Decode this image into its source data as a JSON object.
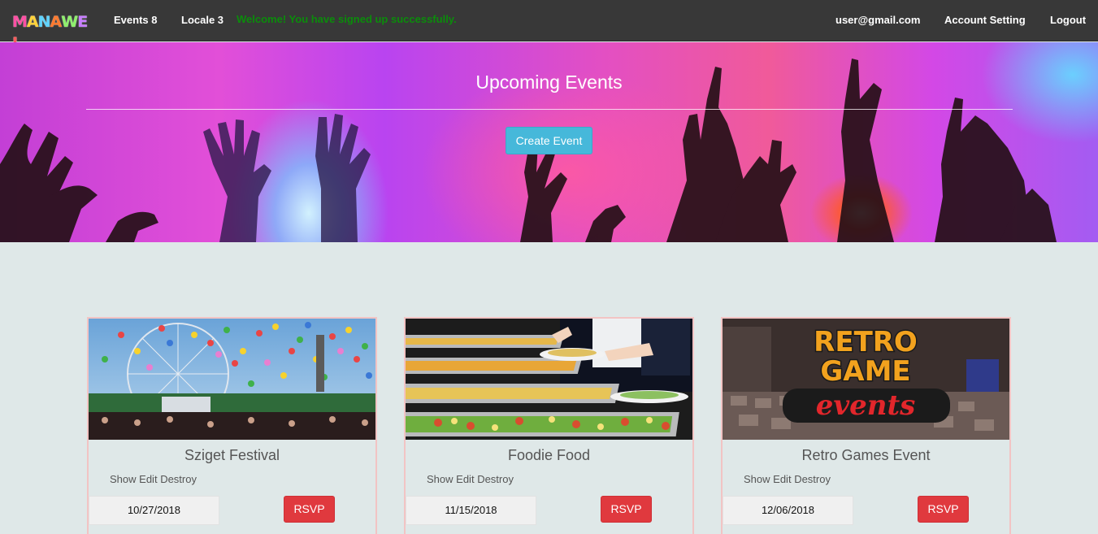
{
  "navbar": {
    "logo_text": "MANAWEI",
    "events_link": "Events 8",
    "locale_link": "Locale 3",
    "flash_message": "Welcome! You have signed up successfully.",
    "user_email": "user@gmail.com",
    "account_setting": "Account Setting",
    "logout": "Logout"
  },
  "hero": {
    "title": "Upcoming Events",
    "create_button": "Create Event"
  },
  "events": [
    {
      "title": "Sziget Festival",
      "show": "Show",
      "edit": "Edit",
      "destroy": "Destroy",
      "date": "10/27/2018",
      "rsvp": "RSVP",
      "image": "festival-ferris-wheel-image"
    },
    {
      "title": "Foodie Food",
      "show": "Show",
      "edit": "Edit",
      "destroy": "Destroy",
      "date": "11/15/2018",
      "rsvp": "RSVP",
      "image": "buffet-food-image"
    },
    {
      "title": "Retro Games Event",
      "show": "Show",
      "edit": "Edit",
      "destroy": "Destroy",
      "date": "12/06/2018",
      "rsvp": "RSVP",
      "image": "retro-game-events-image",
      "image_text": [
        "RETRO",
        "GAME",
        "events"
      ]
    }
  ],
  "colors": {
    "navbar_bg": "#383838",
    "flash_green": "#0b8c0b",
    "page_bg": "#dfe8e8",
    "create_button": "#46b8da",
    "rsvp_button": "#e0393e",
    "card_border": "#f2c4c4"
  }
}
